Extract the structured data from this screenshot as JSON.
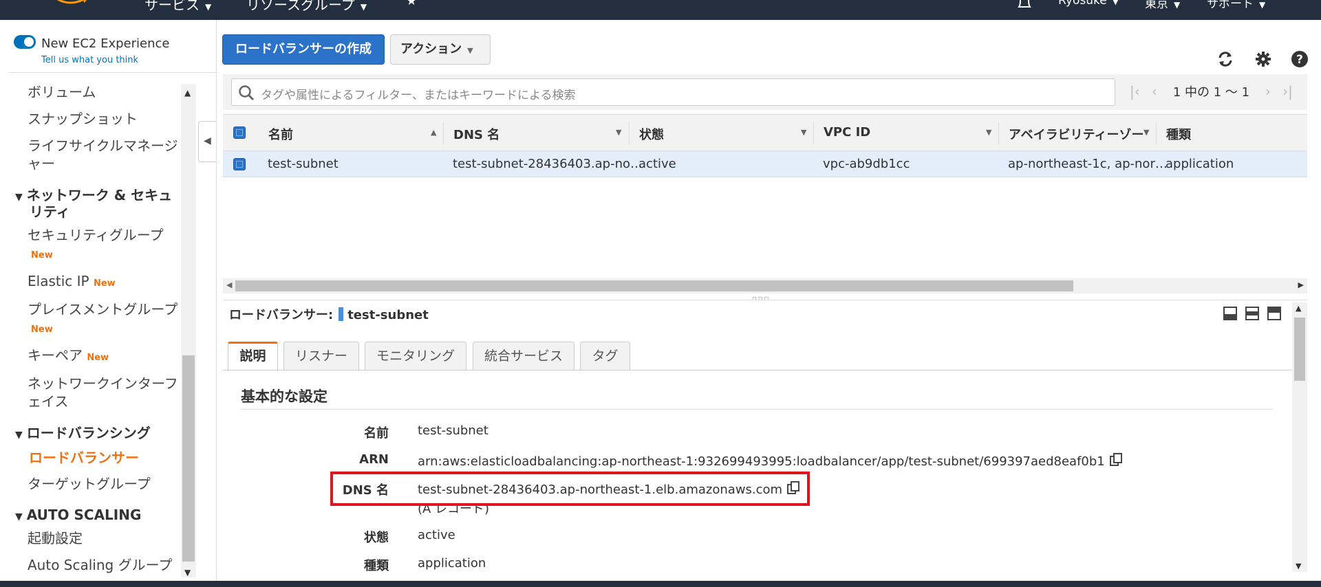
{
  "topnav": {
    "items": [
      {
        "label": "サービス"
      },
      {
        "label": "リソースグループ"
      },
      {
        "label": "Ryosuke"
      },
      {
        "label": "東京"
      },
      {
        "label": "サポート"
      }
    ]
  },
  "sidebar": {
    "new_experience_label": "New EC2 Experience",
    "tell_us_label": "Tell us what you think",
    "new_badge": "New",
    "items": [
      {
        "label": "ボリューム"
      },
      {
        "label": "スナップショット"
      },
      {
        "label": "ライフサイクルマネージ"
      },
      {
        "label": "ャー"
      },
      {
        "label": "ネットワーク & セキュ"
      },
      {
        "label": "リティ"
      },
      {
        "label": "セキュリティグループ"
      },
      {
        "label": "Elastic IP"
      },
      {
        "label": "プレイスメントグループ"
      },
      {
        "label": "キーペア"
      },
      {
        "label": "ネットワークインターフ"
      },
      {
        "label": "ェイス"
      },
      {
        "label": "ロードバランシング"
      },
      {
        "label": "ロードバランサー"
      },
      {
        "label": "ターゲットグループ"
      },
      {
        "label": "AUTO SCALING"
      },
      {
        "label": "起動設定"
      },
      {
        "label": "Auto Scaling グループ"
      }
    ]
  },
  "toolbar": {
    "create_label": "ロードバランサーの作成",
    "action_label": "アクション"
  },
  "filter": {
    "placeholder": "タグや属性によるフィルター、またはキーワードによる検索",
    "pager_text": "1 中の 1 ～ 1"
  },
  "table": {
    "columns": [
      "名前",
      "DNS 名",
      "状態",
      "VPC ID",
      "アベイラビリティーゾーン",
      "種類"
    ],
    "row": {
      "name": "test-subnet",
      "dns": "test-subnet-28436403.ap-no…",
      "state": "active",
      "vpc": "vpc-ab9db1cc",
      "az": "ap-northeast-1c, ap-nor…",
      "type": "application"
    }
  },
  "detail": {
    "title_label": "ロードバランサー:",
    "title_value": "test-subnet",
    "tabs": [
      "説明",
      "リスナー",
      "モニタリング",
      "統合サービス",
      "タグ"
    ],
    "section_title": "基本的な設定",
    "fields": {
      "name_label": "名前",
      "name_value": "test-subnet",
      "arn_label": "ARN",
      "arn_value": "arn:aws:elasticloadbalancing:ap-northeast-1:932699493995:loadbalancer/app/test-subnet/699397aed8eaf0b1",
      "dns_label": "DNS 名",
      "dns_value": "test-subnet-28436403.ap-northeast-1.elb.amazonaws.com",
      "dns_note": "(A レコード)",
      "state_label": "状態",
      "state_value": "active",
      "type_label": "種類",
      "type_value": "application"
    }
  },
  "colors": {
    "nav_bg": "#232f3e",
    "primary": "#2b73c9",
    "accent_orange": "#ec7211",
    "highlight_red": "#e0141e",
    "selected_row": "#e4eefb"
  }
}
